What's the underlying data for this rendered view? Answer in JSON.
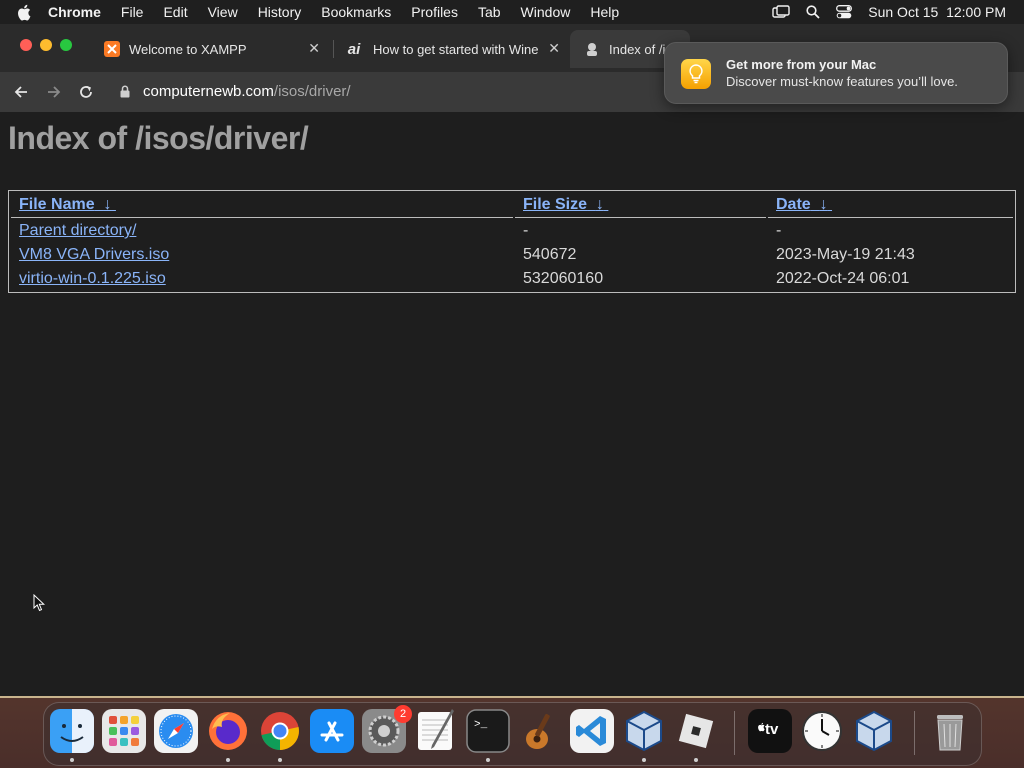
{
  "menubar": {
    "app": "Chrome",
    "items": [
      "File",
      "Edit",
      "View",
      "History",
      "Bookmarks",
      "Profiles",
      "Tab",
      "Window",
      "Help"
    ],
    "datetime": "Sun Oct 15  12:00 PM"
  },
  "tabs": [
    {
      "title": "Welcome to XAMPP",
      "icon": "xampp-icon"
    },
    {
      "title": "How to get started with Wine o",
      "icon": "ai-icon"
    },
    {
      "title": "Index of /is",
      "icon": "site-icon"
    }
  ],
  "address": {
    "host": "computernewb.com",
    "path": "/isos/driver/"
  },
  "page": {
    "heading": "Index of /isos/driver/",
    "columns": {
      "name": "File Name",
      "size": "File Size",
      "date": "Date",
      "sort_arrow": "↓"
    },
    "rows": [
      {
        "name": "Parent directory/",
        "size": "-",
        "date": "-"
      },
      {
        "name": "VM8 VGA Drivers.iso",
        "size": "540672",
        "date": "2023-May-19 21:43"
      },
      {
        "name": "virtio-win-0.1.225.iso",
        "size": "532060160",
        "date": "2022-Oct-24 06:01"
      }
    ]
  },
  "notification": {
    "title": "Get more from your Mac",
    "body": "Discover must-know features you’ll love."
  },
  "dock": {
    "apps": [
      "finder-icon",
      "launchpad-icon",
      "safari-icon",
      "firefox-icon",
      "chrome-icon",
      "app-store-icon",
      "system-settings-icon",
      "textedit-icon",
      "terminal-icon",
      "garageband-icon",
      "vscode-icon",
      "virtualbox-icon",
      "roblox-icon",
      "apple-tv-icon",
      "clock-icon",
      "virtualbox-icon",
      "trash-icon"
    ],
    "settings_badge": "2",
    "appletv_label": "tv"
  },
  "colors": {
    "link": "#8ab4f8",
    "page_bg": "#1e1e1e",
    "heading": "#a0a0a0"
  }
}
